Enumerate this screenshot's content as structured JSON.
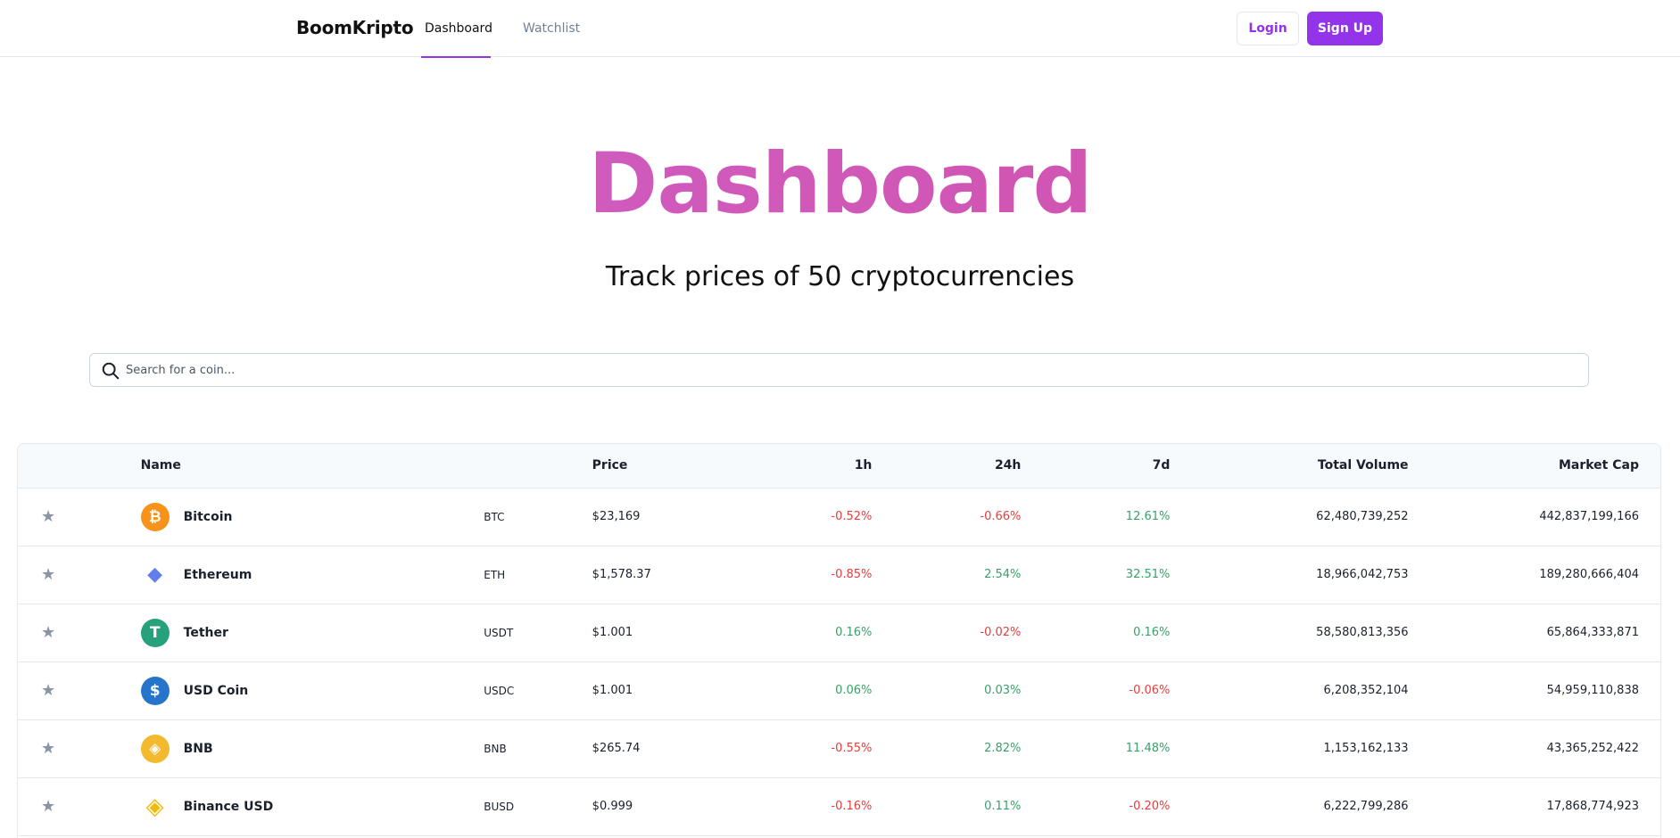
{
  "header": {
    "brand": "BoomKripto",
    "tabs": [
      {
        "label": "Dashboard",
        "active": true
      },
      {
        "label": "Watchlist",
        "active": false
      }
    ],
    "login_label": "Login",
    "signup_label": "Sign Up",
    "accent_color": "#9333ea"
  },
  "hero": {
    "title": "Dashboard",
    "subtitle": "Track prices of 50 cryptocurrencies"
  },
  "search": {
    "placeholder": "Search for a coin...",
    "value": ""
  },
  "table": {
    "headers": {
      "name": "Name",
      "price": "Price",
      "h1": "1h",
      "h24": "24h",
      "d7": "7d",
      "volume": "Total Volume",
      "market_cap": "Market Cap"
    },
    "rows": [
      {
        "name": "Bitcoin",
        "symbol": "BTC",
        "price": "$23,169",
        "h1": "-0.52%",
        "h24": "-0.66%",
        "d7": "12.61%",
        "volume": "62,480,739,252",
        "market_cap": "442,837,199,166",
        "icon": "bitcoin-icon",
        "icon_color": "#f7931a"
      },
      {
        "name": "Ethereum",
        "symbol": "ETH",
        "price": "$1,578.37",
        "h1": "-0.85%",
        "h24": "2.54%",
        "d7": "32.51%",
        "volume": "18,966,042,753",
        "market_cap": "189,280,666,404",
        "icon": "ethereum-icon",
        "icon_color": "#627eea"
      },
      {
        "name": "Tether",
        "symbol": "USDT",
        "price": "$1.001",
        "h1": "0.16%",
        "h24": "-0.02%",
        "d7": "0.16%",
        "volume": "58,580,813,356",
        "market_cap": "65,864,333,871",
        "icon": "tether-icon",
        "icon_color": "#26a17b"
      },
      {
        "name": "USD Coin",
        "symbol": "USDC",
        "price": "$1.001",
        "h1": "0.06%",
        "h24": "0.03%",
        "d7": "-0.06%",
        "volume": "6,208,352,104",
        "market_cap": "54,959,110,838",
        "icon": "usd-coin-icon",
        "icon_color": "#2775ca"
      },
      {
        "name": "BNB",
        "symbol": "BNB",
        "price": "$265.74",
        "h1": "-0.55%",
        "h24": "2.82%",
        "d7": "11.48%",
        "volume": "1,153,162,133",
        "market_cap": "43,365,252,422",
        "icon": "bnb-icon",
        "icon_color": "#f3ba2f"
      },
      {
        "name": "Binance USD",
        "symbol": "BUSD",
        "price": "$0.999",
        "h1": "-0.16%",
        "h24": "0.11%",
        "d7": "-0.20%",
        "volume": "6,222,799,286",
        "market_cap": "17,868,774,923",
        "icon": "binance-usd-icon",
        "icon_color": "#f0b90b"
      }
    ]
  },
  "colors": {
    "positive": "#38a169",
    "negative": "#e53e3e",
    "title_gradient_start": "#cc62c9",
    "title_gradient_end": "#d44ea6"
  }
}
